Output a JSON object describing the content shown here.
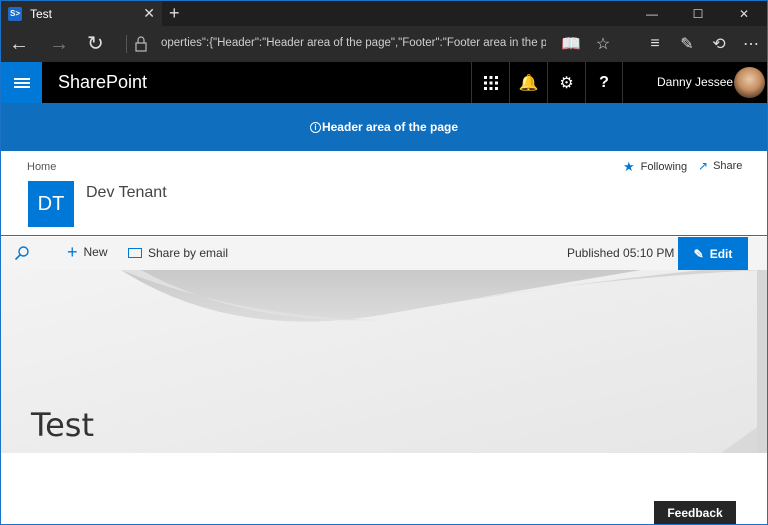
{
  "browser": {
    "tab_title": "Test",
    "tab_favicon_text": "S>",
    "url": "operties\":{\"Header\":\"Header area of the page\",\"Footer\":\"Footer area in the page\"}}}",
    "window_buttons": [
      "minimize-icon",
      "maximize-icon",
      "close-icon"
    ]
  },
  "suitebar": {
    "brand": "SharePoint",
    "user_name": "Danny Jessee",
    "icons": [
      "app-launcher-icon",
      "bell-icon",
      "gear-icon",
      "help-icon"
    ]
  },
  "header_placeholder": {
    "text": "Header area of the page"
  },
  "site": {
    "breadcrumb": "Home",
    "logo_initials": "DT",
    "title": "Dev Tenant",
    "following_label": "Following",
    "share_label": "Share"
  },
  "commandbar": {
    "new_label": "New",
    "share_email_label": "Share by email",
    "published_text": "Published 05:10 PM",
    "edit_label": "Edit"
  },
  "page": {
    "title": "Test"
  },
  "feedback_label": "Feedback",
  "colors": {
    "accent": "#0078d7",
    "header_band": "#106ebe",
    "suitebar_bg": "#000000",
    "browser_chrome": "#2b2b2b"
  }
}
